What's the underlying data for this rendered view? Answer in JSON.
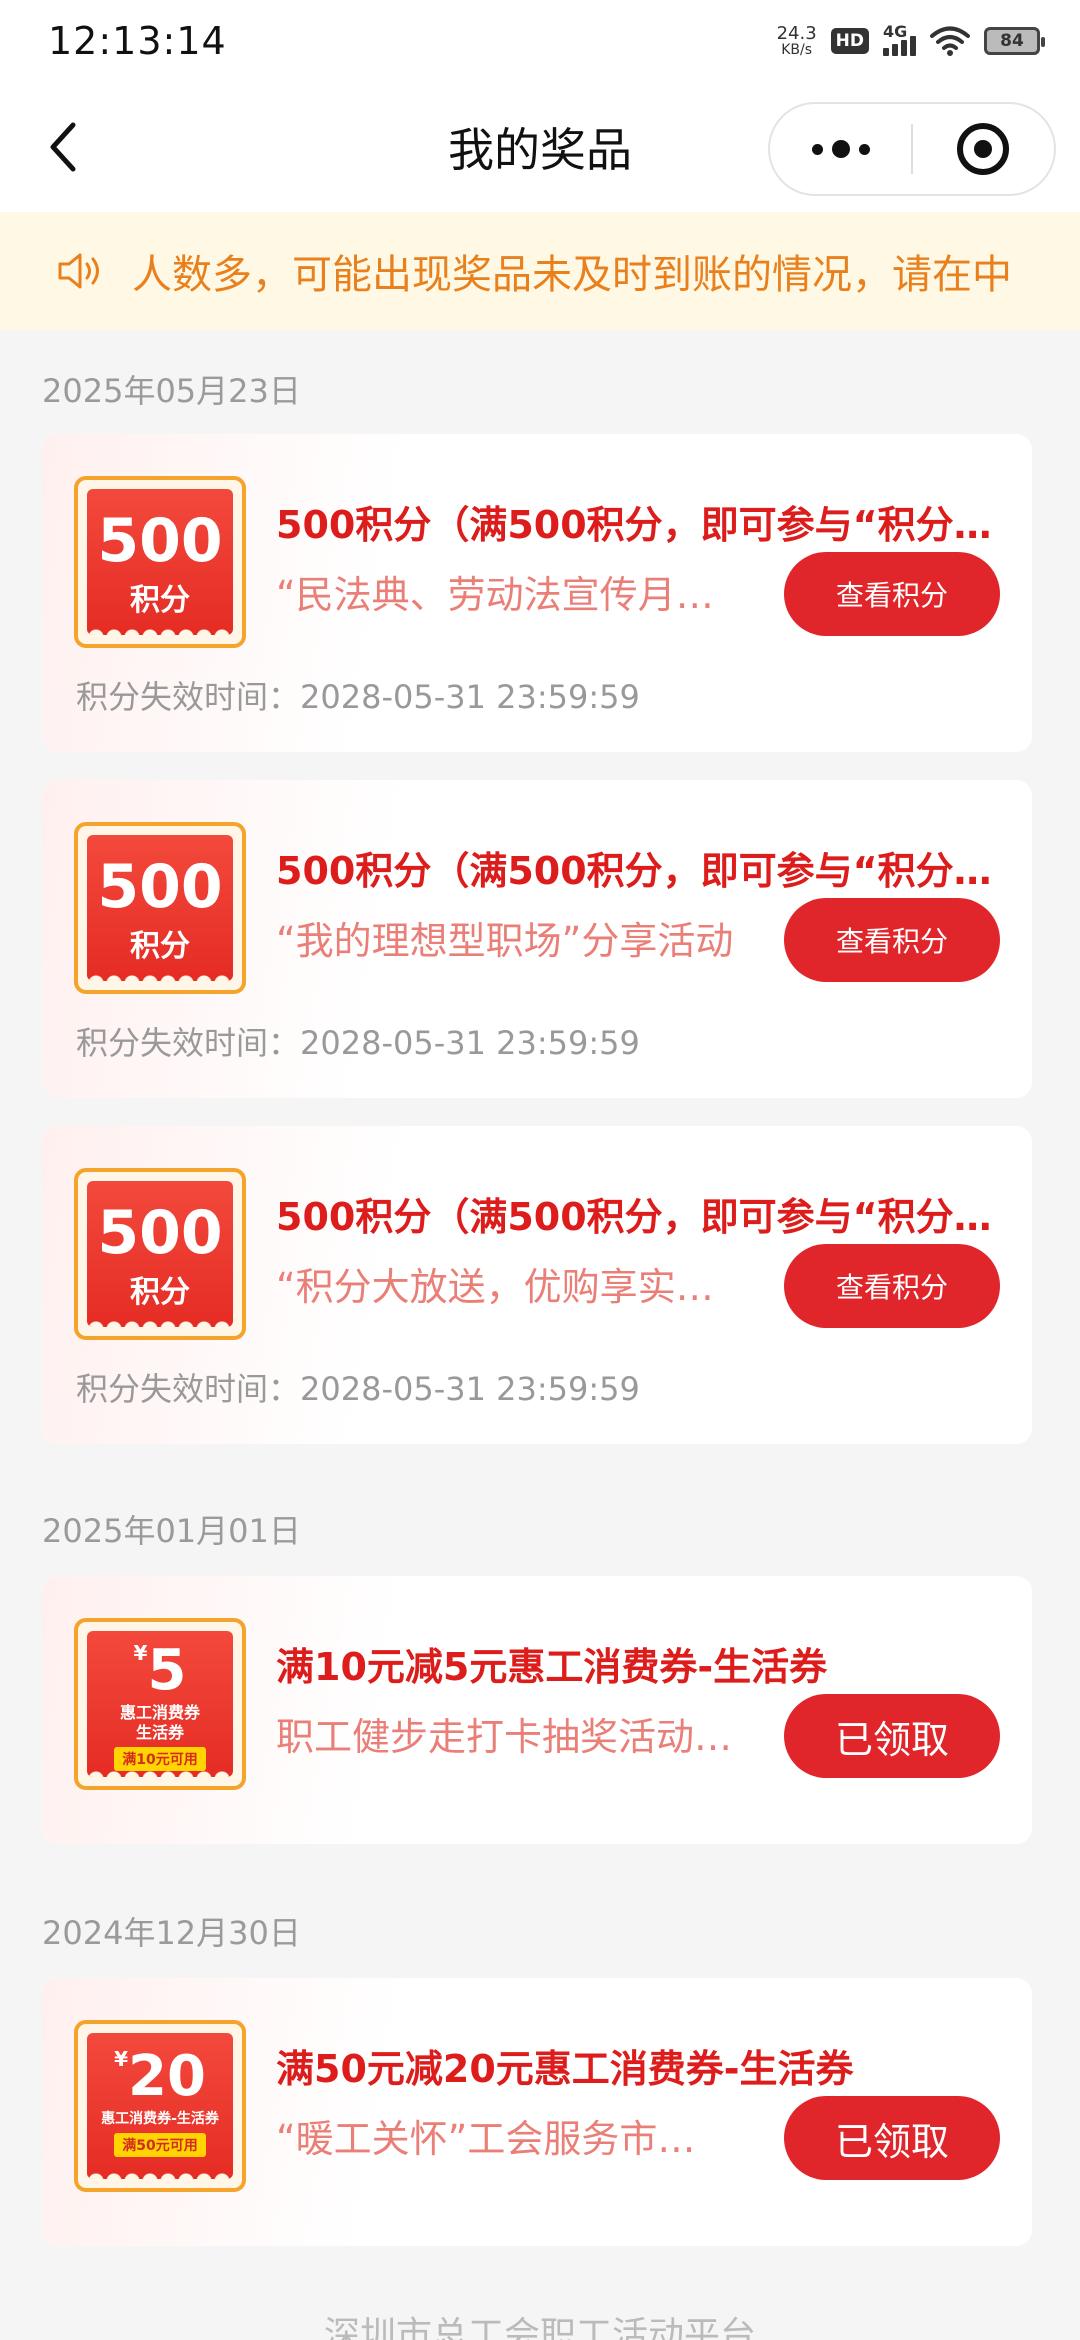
{
  "status_bar": {
    "time": "12:13:14",
    "net_speed_value": "24.3",
    "net_speed_unit": "KB/s",
    "hd_label": "HD",
    "network_label": "4G",
    "battery_level": "84"
  },
  "header": {
    "title": "我的奖品"
  },
  "notice": {
    "text": "人数多，可能出现奖品未及时到账的情况，请在中"
  },
  "groups": [
    {
      "date": "2025年05月23日",
      "items": [
        {
          "badge_number": "500",
          "badge_unit": "积分",
          "title": "500积分（满500积分，即可参与“积分…",
          "subtitle": "“民法典、劳动法宣传月…",
          "button": "查看积分",
          "expire": "积分失效时间：2028-05-31 23:59:59"
        },
        {
          "badge_number": "500",
          "badge_unit": "积分",
          "title": "500积分（满500积分，即可参与“积分…",
          "subtitle": "“我的理想型职场”分享活动",
          "button": "查看积分",
          "expire": "积分失效时间：2028-05-31 23:59:59"
        },
        {
          "badge_number": "500",
          "badge_unit": "积分",
          "title": "500积分（满500积分，即可参与“积分…",
          "subtitle": "“积分大放送，优购享实…",
          "button": "查看积分",
          "expire": "积分失效时间：2028-05-31 23:59:59"
        }
      ]
    },
    {
      "date": "2025年01月01日",
      "items": [
        {
          "badge_currency": "¥",
          "badge_value": "5",
          "badge_label_1": "惠工消费券",
          "badge_label_2": "生活券",
          "badge_condition": "满10元可用",
          "title": "满10元减5元惠工消费券-生活券",
          "subtitle": "职工健步走打卡抽奖活动…",
          "button": "已领取"
        }
      ]
    },
    {
      "date": "2024年12月30日",
      "items": [
        {
          "badge_currency": "¥",
          "badge_value": "20",
          "badge_label_1": "惠工消费券-生活券",
          "badge_condition": "满50元可用",
          "title": "满50元减20元惠工消费券-生活券",
          "subtitle": "“暖工关怀”工会服务市…",
          "button": "已领取"
        }
      ]
    }
  ],
  "footer": {
    "text": "深圳市总工会职工活动平台"
  },
  "colors": {
    "accent_red": "#e0262b",
    "title_red": "#dd1c1c",
    "notice_orange": "#e8801e",
    "notice_bg": "#fff8e4"
  }
}
